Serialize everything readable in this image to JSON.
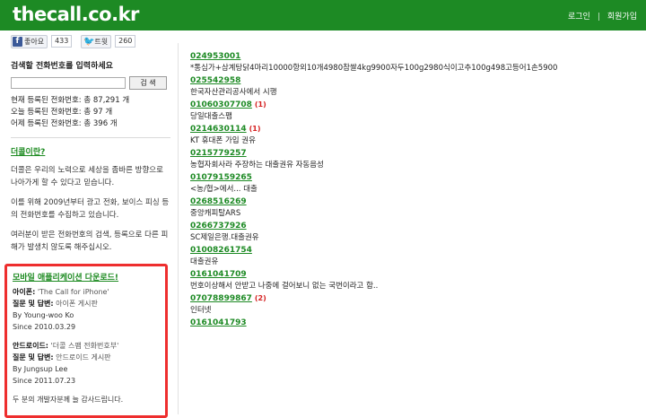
{
  "header": {
    "logo": "thecall.co.kr",
    "login": "로그인",
    "signup": "회원가입",
    "bg_color": "#1d8a24"
  },
  "social": {
    "fb_label": "좋아요",
    "fb_count": "433",
    "tw_label": "트윗",
    "tw_count": "260"
  },
  "search": {
    "title": "검색할 전화번호를 입력하세요",
    "value": "",
    "button": "검 색"
  },
  "stats": {
    "current": "현재 등록된 전화번호: 총 87,291 개",
    "today": "오늘 등록된 전화번호: 총 97 개",
    "yesterday": "어제 등록된 전화번호: 총 396 개"
  },
  "about": {
    "link": "더콜이란?",
    "p1": "더콜은 우리의 노력으로 세상을 좀바른 방향으로 나아가게 할 수 있다고 믿습니다.",
    "p2": "이를 위해 2009년부터 광고 전화, 보이스 피싱 등의 전화번호를 수집하고 있습니다.",
    "p3": "여러분이 받은 전화번호의 검색, 등록으로 다른 피해가 발생치 않도록 해주십시오."
  },
  "mobile": {
    "title": "모바일 애플리케이션 다운로드!",
    "iphone_label": "아이폰:",
    "iphone_name": "'The Call for iPhone'",
    "iphone_qa_label": "질문 및 답변:",
    "iphone_qa": "아이폰 게시판",
    "iphone_by": "By Young-woo Ko",
    "iphone_since": "Since 2010.03.29",
    "android_label": "안드로이드:",
    "android_name": "'더콜 스팸 전화번호부'",
    "android_qa_label": "질문 및 답변:",
    "android_qa": "안드로이드 게시판",
    "android_by": "By Jungsup Lee",
    "android_since": "Since 2011.07.23",
    "thanks": "두 분의 개발자분께 늘 감사드립니다.",
    "highlight_color": "#ee2e2e"
  },
  "entries": [
    {
      "number": "024953001",
      "count": "",
      "desc": "*통심가+삼계탕닭4마리10000항외10개4980참쌀4kg9900자두100g2980식이고추100g498고등어1손5900"
    },
    {
      "number": "025542958",
      "count": "",
      "desc": "한국자산관리공사에서 시행"
    },
    {
      "number": "01060307708",
      "count": "(1)",
      "desc": "당일대출스팸"
    },
    {
      "number": "0214630114",
      "count": "(1)",
      "desc": "KT 휴대폰 가입 권유"
    },
    {
      "number": "0215779257",
      "count": "",
      "desc": "농협자회사라 주장하는 대출권유 자동음성"
    },
    {
      "number": "01079159265",
      "count": "",
      "desc": "<농/협>에서... 대출"
    },
    {
      "number": "0268516269",
      "count": "",
      "desc": "중앙캐피탈ARS"
    },
    {
      "number": "0266737926",
      "count": "",
      "desc": "SC제일은행.대출권유"
    },
    {
      "number": "01008261754",
      "count": "",
      "desc": "대출권유"
    },
    {
      "number": "0161041709",
      "count": "",
      "desc": "번호이상해서 안받고 나중에 걸어보니 없는 국번이라고 함.."
    },
    {
      "number": "07078899867",
      "count": "(2)",
      "desc": "인터넷"
    },
    {
      "number": "0161041793",
      "count": "",
      "desc": ""
    }
  ]
}
